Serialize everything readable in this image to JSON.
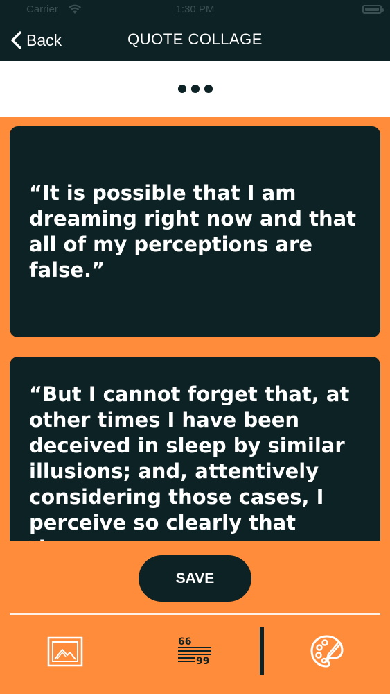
{
  "status_bar": {
    "carrier": "Carrier",
    "time": "1:30 PM"
  },
  "nav": {
    "back_label": "Back",
    "title": "QUOTE COLLAGE"
  },
  "quotes": [
    {
      "text": "“It is possible that I am dreaming right now and that all of my perceptions are false.”"
    },
    {
      "text": "“But I cannot forget that, at other times I have been deceived in sleep by similar illusions; and, attentively considering those cases, I perceive so clearly that there"
    }
  ],
  "actions": {
    "save_label": "SAVE"
  },
  "tab_bar": {
    "icons": [
      "image-frame-icon",
      "quote-text-icon",
      "palette-icon"
    ]
  },
  "colors": {
    "background": "#FF8C3B",
    "dark": "#0D2224",
    "white": "#FFFFFF"
  }
}
